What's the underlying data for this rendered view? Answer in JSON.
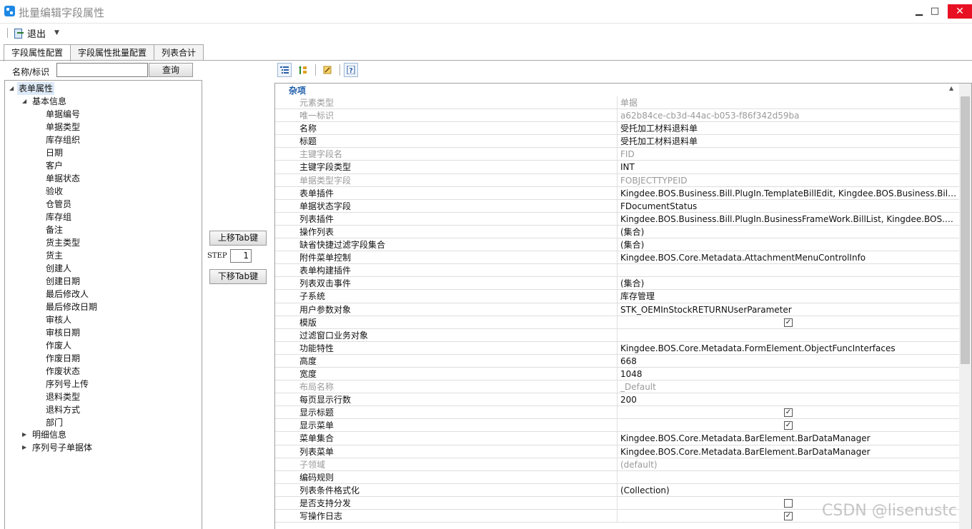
{
  "window": {
    "title": "批量编辑字段属性",
    "minimize_symbol": "▁",
    "maximize_symbol": "□",
    "close_symbol": "✕"
  },
  "toolbar": {
    "exit_label": "退出",
    "exit_caret": "▼"
  },
  "tabs": [
    {
      "label": "字段属性配置",
      "active": true
    },
    {
      "label": "字段属性批量配置",
      "active": false
    },
    {
      "label": "列表合计",
      "active": false
    }
  ],
  "search": {
    "label": "名称/标识",
    "value": "",
    "button_label": "查询"
  },
  "tree": {
    "root": "表单属性",
    "groups": [
      {
        "label": "基本信息",
        "expanded": true,
        "children": [
          "单据编号",
          "单据类型",
          "库存组织",
          "日期",
          "客户",
          "单据状态",
          "验收",
          "仓管员",
          "库存组",
          "备注",
          "货主类型",
          "货主",
          "创建人",
          "创建日期",
          "最后修改人",
          "最后修改日期",
          "审核人",
          "审核日期",
          "作废人",
          "作废日期",
          "作废状态",
          "序列号上传",
          "退料类型",
          "退料方式",
          "部门"
        ]
      },
      {
        "label": "明细信息",
        "expanded": false,
        "children": []
      },
      {
        "label": "序列号子单据体",
        "expanded": false,
        "children": []
      }
    ]
  },
  "middle": {
    "move_up_label": "上移Tab键",
    "move_down_label": "下移Tab键",
    "step_label": "STEP",
    "step_value": "1"
  },
  "right_toolbar_icons": [
    "categorized-icon",
    "sort-alpha-icon",
    "property-pages-icon",
    "help-icon"
  ],
  "grid": {
    "category": "杂项",
    "collapse_symbol": "▲",
    "rows": [
      {
        "name": "元素类型",
        "value": "单据",
        "readonly": true
      },
      {
        "name": "唯一标识",
        "value": "a62b84ce-cb3d-44ac-b053-f86f342d59ba",
        "readonly": true
      },
      {
        "name": "名称",
        "value": "受托加工材料退料单"
      },
      {
        "name": "标题",
        "value": "受托加工材料退料单"
      },
      {
        "name": "主键字段名",
        "value": "FID",
        "readonly": true
      },
      {
        "name": "主键字段类型",
        "value": "INT"
      },
      {
        "name": "单据类型字段",
        "value": "FOBJECTTYPEID",
        "readonly": true
      },
      {
        "name": "表单插件",
        "value": "Kingdee.BOS.Business.Bill.PlugIn.TemplateBillEdit, Kingdee.BOS.Business.Bill|Kingdee.BOS.Business.Bill"
      },
      {
        "name": "单据状态字段",
        "value": "FDocumentStatus"
      },
      {
        "name": "列表插件",
        "value": "Kingdee.BOS.Business.Bill.PlugIn.BusinessFrameWork.BillList, Kingdee.BOS.Business.Bill"
      },
      {
        "name": "操作列表",
        "value": "(集合)"
      },
      {
        "name": "缺省快捷过滤字段集合",
        "value": "(集合)"
      },
      {
        "name": "附件菜单控制",
        "value": "Kingdee.BOS.Core.Metadata.AttachmentMenuControlInfo"
      },
      {
        "name": "表单构建插件",
        "value": ""
      },
      {
        "name": "列表双击事件",
        "value": "(集合)"
      },
      {
        "name": "子系统",
        "value": "库存管理"
      },
      {
        "name": "用户参数对象",
        "value": "STK_OEMInStockRETURNUserParameter"
      },
      {
        "name": "模版",
        "value": "",
        "checkbox": true,
        "checked": true
      },
      {
        "name": "过滤窗口业务对象",
        "value": ""
      },
      {
        "name": "功能特性",
        "value": "Kingdee.BOS.Core.Metadata.FormElement.ObjectFuncInterfaces"
      },
      {
        "name": "高度",
        "value": "668"
      },
      {
        "name": "宽度",
        "value": "1048"
      },
      {
        "name": "布局名称",
        "value": "_Default",
        "readonly": true
      },
      {
        "name": "每页显示行数",
        "value": "200"
      },
      {
        "name": "显示标题",
        "value": "",
        "checkbox": true,
        "checked": true
      },
      {
        "name": "显示菜单",
        "value": "",
        "checkbox": true,
        "checked": true
      },
      {
        "name": "菜单集合",
        "value": "Kingdee.BOS.Core.Metadata.BarElement.BarDataManager"
      },
      {
        "name": "列表菜单",
        "value": "Kingdee.BOS.Core.Metadata.BarElement.BarDataManager"
      },
      {
        "name": "子领域",
        "value": "(default)",
        "readonly": true
      },
      {
        "name": "编码规则",
        "value": ""
      },
      {
        "name": "列表条件格式化",
        "value": "(Collection)"
      },
      {
        "name": "是否支持分发",
        "value": "",
        "checkbox": true,
        "checked": false
      },
      {
        "name": "写操作日志",
        "value": "",
        "checkbox": true,
        "checked": true
      }
    ]
  },
  "watermark": "CSDN @lisenustc",
  "colors": {
    "category_text": "#1a5aa8",
    "selection": "#dde9f7",
    "close_button": "#e81123"
  }
}
